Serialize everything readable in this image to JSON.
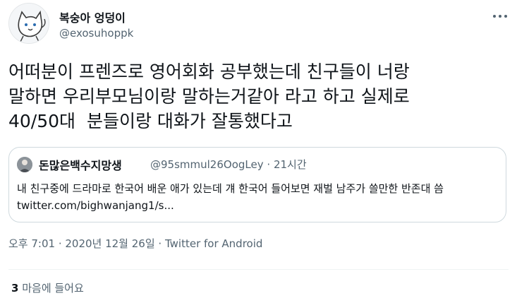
{
  "author": {
    "display_name": "복숭아 엉덩이",
    "handle": "@exosuhoppk",
    "avatar_icon": "cat-drawing-avatar-icon",
    "more_icon": "more-options-icon"
  },
  "tweet": {
    "text": "어떠분이 프렌즈로 영어회화 공부했는데 친구들이 너랑\n말하면 우리부모님이랑 말하는거같아 라고 하고 실제로\n40/50대  분들이랑 대화가 잘통했다고"
  },
  "quoted_tweet": {
    "display_name": "돈많은백수지망생",
    "handle": "@95smmul26OogLey",
    "separator": "·",
    "time": "21시간",
    "text": "내 친구중에 드라마로 한국어 배운 애가 있는데 걔 한국어 들어보면 재벌 남주가 쓸만한 반존대 씀 twitter.com/bighwanjang1/s..."
  },
  "meta": {
    "timestamp": "오후 7:01 · 2020년 12월 26일",
    "separator": "·",
    "source_app": "Twitter for Android"
  },
  "stats": {
    "likes_count": "3",
    "likes_label": "마음에 들어요"
  },
  "colors": {
    "text_primary": "#0f1419",
    "text_secondary": "#536471",
    "border": "#cfd9de"
  }
}
